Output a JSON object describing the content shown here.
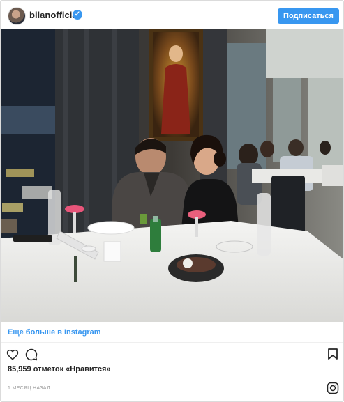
{
  "header": {
    "username": "bilanofficial",
    "verified_glyph": "✓",
    "follow_label": "Подписаться",
    "accent_color": "#3897f0"
  },
  "post": {
    "more_link": "Еще больше в Instagram",
    "likes_text": "85,959 отметок «Нравится»",
    "timestamp": "1 МЕСЯЦ НАЗАД"
  },
  "icons": {
    "like": "heart-icon",
    "comment": "comment-icon",
    "save": "bookmark-icon",
    "brand": "instagram-icon"
  }
}
